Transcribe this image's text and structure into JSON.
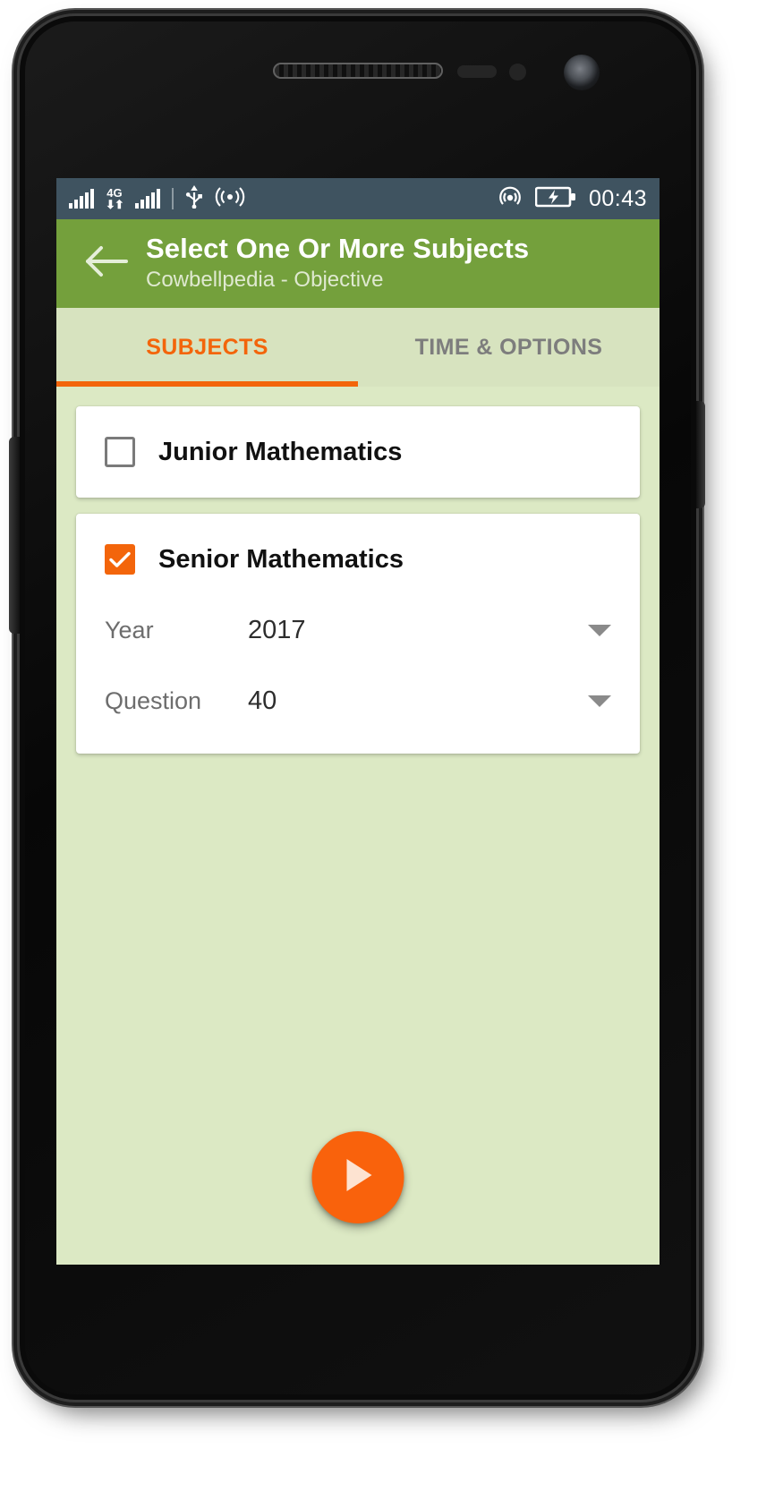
{
  "status_bar": {
    "time": "00:43",
    "network_type": "4G",
    "icons": [
      "signal-bars-icon",
      "network-4g-icon",
      "signal-bars-secondary-icon",
      "usb-icon",
      "broadcast-icon",
      "hotspot-icon",
      "battery-charging-icon"
    ]
  },
  "app_bar": {
    "back_icon": "arrow-left-icon",
    "title": "Select One Or More Subjects",
    "subtitle": "Cowbellpedia - Objective"
  },
  "tabs": [
    {
      "label": "SUBJECTS",
      "active": true
    },
    {
      "label": "TIME & OPTIONS",
      "active": false
    }
  ],
  "subjects": [
    {
      "label": "Junior Mathematics",
      "checked": false,
      "options": []
    },
    {
      "label": "Senior Mathematics",
      "checked": true,
      "options": [
        {
          "label": "Year",
          "value": "2017",
          "caret": "chevron-down-icon"
        },
        {
          "label": "Question",
          "value": "40",
          "caret": "chevron-down-icon"
        }
      ]
    }
  ],
  "fab": {
    "icon": "play-icon",
    "label": "Start"
  },
  "colors": {
    "app_bar_green": "#74a03c",
    "accent_orange": "#f3650b",
    "fab_orange": "#f9620c",
    "screen_background": "#dce9c4",
    "tab_bar_background": "#d7e3bf",
    "status_bar": "#3f5360"
  }
}
